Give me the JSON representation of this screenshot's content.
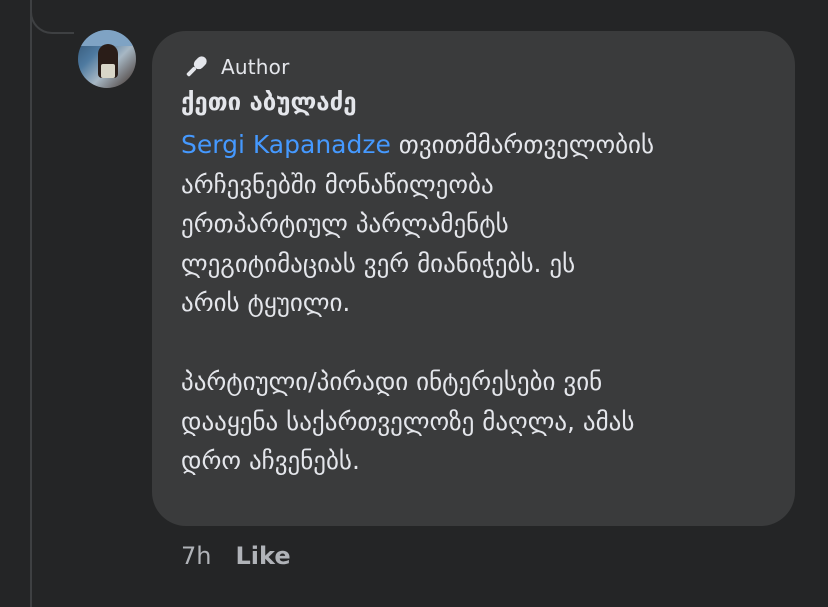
{
  "comment": {
    "badge": {
      "icon": "microphone-icon",
      "label": "Author"
    },
    "author_name": "ქეთი აბულაძე",
    "mention": "Sergi Kapanadze",
    "lines": [
      " თვითმმართველობის",
      "არჩევნებში მონაწილეობა",
      "ერთპარტიულ პარლამენტს",
      "ლეგიტიმაციას ვერ მიანიჭებს. ეს",
      "არის ტყუილი.",
      "",
      "პარტიული/პირადი ინტერესები ვინ",
      "დააყენა საქართველოზე მაღლა, ამას",
      "დრო აჩვენებს."
    ],
    "timestamp": "7h",
    "like_label": "Like"
  },
  "colors": {
    "background": "#242526",
    "bubble": "#3a3b3c",
    "text": "#e4e6eb",
    "mention": "#4599ff",
    "secondary_text": "#b0b3b8"
  }
}
